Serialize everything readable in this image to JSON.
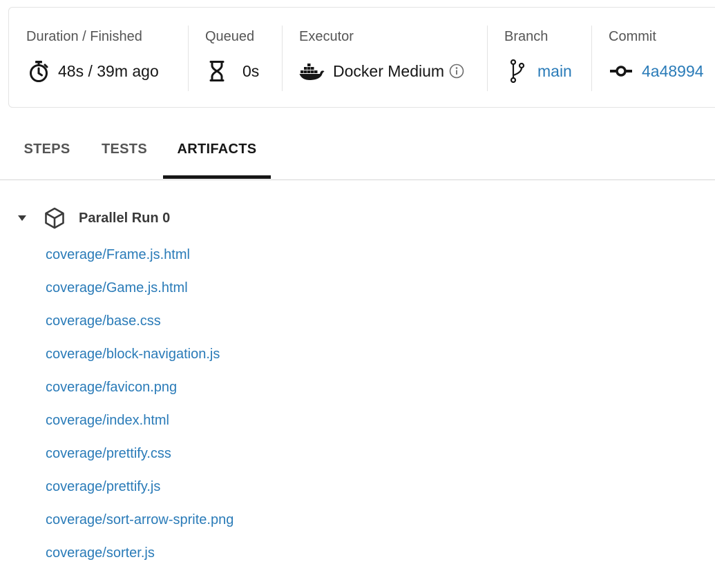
{
  "summary": {
    "duration": {
      "label": "Duration / Finished",
      "value": "48s / 39m ago",
      "icon": "stopwatch-icon"
    },
    "queued": {
      "label": "Queued",
      "value": "0s",
      "icon": "hourglass-icon"
    },
    "executor": {
      "label": "Executor",
      "value": "Docker Medium",
      "icon": "docker-icon",
      "info_icon": "info-icon"
    },
    "branch": {
      "label": "Branch",
      "value": "main",
      "icon": "git-branch-icon"
    },
    "commit": {
      "label": "Commit",
      "value": "4a48994",
      "icon": "git-commit-icon"
    }
  },
  "tabs": [
    {
      "label": "STEPS",
      "active": false
    },
    {
      "label": "TESTS",
      "active": false
    },
    {
      "label": "ARTIFACTS",
      "active": true
    }
  ],
  "artifacts": {
    "group": {
      "title": "Parallel Run 0",
      "expanded": true,
      "icon": "package-icon",
      "toggle_icon": "caret-down-icon"
    },
    "items": [
      "coverage/Frame.js.html",
      "coverage/Game.js.html",
      "coverage/base.css",
      "coverage/block-navigation.js",
      "coverage/favicon.png",
      "coverage/index.html",
      "coverage/prettify.css",
      "coverage/prettify.js",
      "coverage/sort-arrow-sprite.png",
      "coverage/sorter.js"
    ]
  },
  "colors": {
    "link": "#2a7bb8",
    "text": "#161616",
    "muted": "#555555",
    "border": "#e3e3e3"
  }
}
